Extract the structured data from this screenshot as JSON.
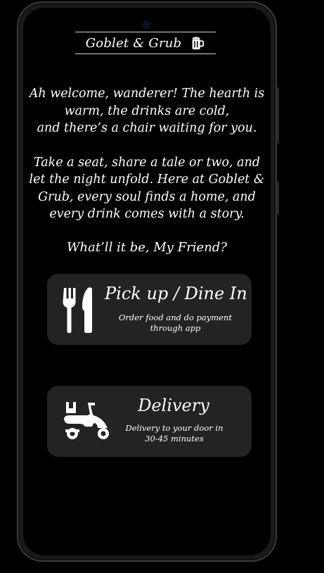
{
  "app": {
    "title": "Goblet & Grub",
    "brand_icon": "beer-mug-icon"
  },
  "intro": {
    "paragraph1_line1": "Ah welcome, wanderer! The hearth is",
    "paragraph1_line2": "warm, the drinks are cold,",
    "paragraph1_line3": "and there’s a chair waiting for you.",
    "paragraph2_line1": "Take a seat, share a tale or two, and",
    "paragraph2_line2": "let the night unfold. Here at Goblet &",
    "paragraph2_line3": "Grub, every soul finds a home, and",
    "paragraph2_line4": "every drink comes with a story.",
    "question": "What’ll it be, My Friend?"
  },
  "options": {
    "pickup": {
      "title": "Pick up / Dine In",
      "description_line1": "Order food and do payment",
      "description_line2": "through app",
      "icon": "fork-knife-icon"
    },
    "delivery": {
      "title": "Delivery",
      "description_line1": "Delivery to your door in",
      "description_line2": "30-45 minutes",
      "icon": "delivery-scooter-icon"
    }
  },
  "colors": {
    "background": "#000000",
    "card": "#232323",
    "text": "#ffffff",
    "frame": "#1a1a1a"
  }
}
